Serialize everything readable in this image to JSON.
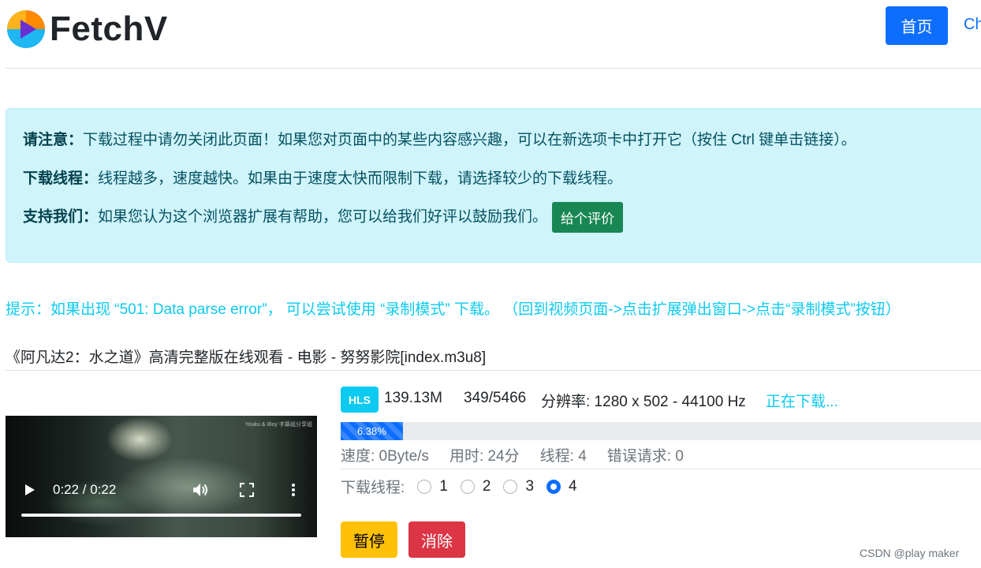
{
  "app": {
    "name": "FetchV"
  },
  "header": {
    "home_label": "首页",
    "nav_link_label": "Ch"
  },
  "alert": {
    "line1_label": "请注意：",
    "line1_text": "下载过程中请勿关闭此页面！如果您对页面中的某些内容感兴趣，可以在新选项卡中打开它（按住 Ctrl 键单击链接）。",
    "line2_label": "下载线程：",
    "line2_text": "线程越多，速度越快。如果由于速度太快而限制下载，请选择较少的下载线程。",
    "line3_label": "支持我们：",
    "line3_text": "如果您认为这个浏览器扩展有帮助，您可以给我们好评以鼓励我们。",
    "rate_button": "给个评价"
  },
  "tip": "提示：如果出现 “501: Data parse error”， 可以尝试使用 “录制模式” 下载。 （回到视频页面->点击扩展弹出窗口->点击“录制模式”按钮）",
  "file": {
    "title": "《阿凡达2：水之道》高清完整版在线观看 - 电影 - 努努影院[index.m3u8]"
  },
  "video": {
    "time": "0:22 / 0:22",
    "watermark": "Youku & iBoy 字幕组分享组"
  },
  "download": {
    "type_badge": "HLS",
    "size": "139.13M",
    "segments": "349/5466",
    "resolution": "分辨率: 1280 x 502 - 44100 Hz",
    "status": "正在下载...",
    "progress_label": "6.38%",
    "progress_value": 6.38,
    "speed": "速度: 0Byte/s",
    "elapsed": "用时: 24分",
    "threads_info": "线程: 4",
    "errors": "错误请求: 0"
  },
  "threads": {
    "label": "下载线程:",
    "options": [
      "1",
      "2",
      "3",
      "4"
    ],
    "selected": "4"
  },
  "buttons": {
    "pause": "暂停",
    "delete": "消除"
  },
  "footer": {
    "credit": "CSDN @play maker"
  },
  "colors": {
    "primary": "#0d6efd",
    "info": "#0dcaf0",
    "success": "#198754",
    "warning": "#ffc107",
    "danger": "#dc3545"
  }
}
